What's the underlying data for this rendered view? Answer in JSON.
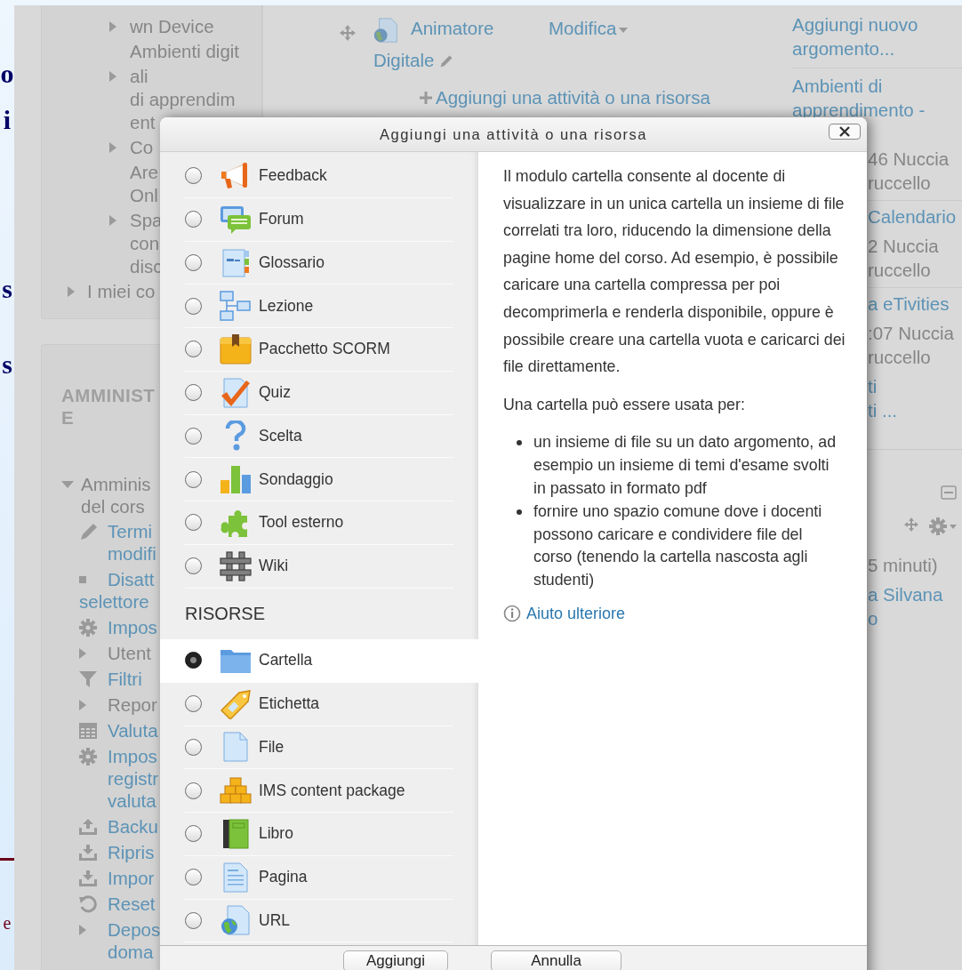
{
  "slide": {
    "letters": [
      {
        "text": "o",
        "kind": "title"
      },
      {
        "text": "i",
        "kind": "title"
      },
      {
        "text": "s",
        "kind": "title"
      },
      {
        "text": "s",
        "kind": "title"
      },
      {
        "text": "e",
        "kind": "footer"
      }
    ]
  },
  "left_column": {
    "cards": [
      {
        "items": [
          {
            "children": [
              {
                "kind": "collapsed",
                "link": false,
                "lines": [
                  "wn Device"
                ]
              },
              {
                "kind": "plain",
                "link": false,
                "lines": [
                  "Ambienti digit"
                ]
              },
              {
                "kind": "collapsed",
                "link": false,
                "lines": [
                  "ali",
                  "di apprendim",
                  "ent"
                ]
              },
              {
                "kind": "collapsed",
                "link": false,
                "lines": [
                  "Co"
                ]
              },
              {
                "kind": "plain",
                "link": false,
                "lines": [
                  "Are",
                  "Onl"
                ]
              },
              {
                "kind": "collapsed",
                "link": false,
                "lines": [
                  "Spa",
                  "con",
                  "disc"
                ]
              }
            ]
          },
          {
            "kind": "collapsed",
            "link": false,
            "lines": [
              "I miei co"
            ]
          }
        ]
      },
      {
        "heading": [
          "AMMINIST",
          "E"
        ],
        "items": [
          {
            "kind": "expanded",
            "link": false,
            "lines": [
              "Amminis",
              "del cors"
            ],
            "children": [
              {
                "kind": "edit",
                "link": true,
                "lines": [
                  "Termi",
                  "modifi"
                ]
              },
              {
                "kind": "toggle",
                "link": true,
                "lines": [
                  "Disatt",
                  "selettore"
                ]
              },
              {
                "kind": "settings",
                "link": true,
                "lines": [
                  "Impos"
                ]
              },
              {
                "kind": "collapsed",
                "link": false,
                "lines": [
                  "Utent"
                ]
              },
              {
                "kind": "filter",
                "link": true,
                "lines": [
                  "Filtri"
                ]
              },
              {
                "kind": "collapsed",
                "link": false,
                "lines": [
                  "Repor"
                ]
              },
              {
                "kind": "grades",
                "link": true,
                "lines": [
                  "Valuta"
                ]
              },
              {
                "kind": "settings",
                "link": true,
                "lines": [
                  "Impos",
                  "registr",
                  "valuta"
                ]
              },
              {
                "kind": "backup",
                "link": true,
                "lines": [
                  "Backu"
                ]
              },
              {
                "kind": "restore",
                "link": true,
                "lines": [
                  "Ripris"
                ]
              },
              {
                "kind": "restore",
                "link": true,
                "lines": [
                  "Impor"
                ]
              },
              {
                "kind": "reset",
                "link": true,
                "lines": [
                  "Reset"
                ]
              },
              {
                "kind": "collapsed",
                "link": true,
                "lines": [
                  "Depos",
                  "doma"
                ]
              }
            ]
          }
        ]
      }
    ]
  },
  "middle_column": {
    "activity_lines": [
      "Animatore",
      "Digitale"
    ],
    "edit_menu": "Modifica",
    "add_link": "Aggiungi una attività o una risorsa"
  },
  "right_column": {
    "top_entries": [
      {
        "kind": "link",
        "lines": [
          "Aggiungi nuovo",
          "argomento..."
        ]
      },
      {
        "kind": "divider"
      },
      {
        "kind": "link",
        "lines": [
          "Ambienti di",
          "apprendimento -"
        ]
      }
    ],
    "side_entries": [
      {
        "kind": "meta",
        "lines": [
          "46 Nuccia",
          "ruccello"
        ]
      },
      {
        "kind": "divider"
      },
      {
        "kind": "link",
        "lines": [
          "Calendario"
        ]
      },
      {
        "kind": "meta",
        "lines": [
          "2 Nuccia",
          "ruccello"
        ]
      },
      {
        "kind": "divider"
      },
      {
        "kind": "link",
        "lines": [
          "a eTivities"
        ]
      },
      {
        "kind": "meta",
        "lines": [
          ":07 Nuccia",
          "ruccello"
        ]
      },
      {
        "kind": "link",
        "lines": [
          "ti",
          "ti ..."
        ]
      },
      {
        "kind": "block-end"
      },
      {
        "kind": "toolbar"
      },
      {
        "kind": "meta",
        "lines": [
          "5 minuti)"
        ]
      },
      {
        "kind": "link",
        "lines": [
          "a Silvana",
          "o"
        ]
      }
    ]
  },
  "dialog": {
    "title": "Aggiungi una attività o una risorsa",
    "activities": [
      {
        "label": "Feedback",
        "selected": false
      },
      {
        "label": "Forum",
        "selected": false
      },
      {
        "label": "Glossario",
        "selected": false
      },
      {
        "label": "Lezione",
        "selected": false
      },
      {
        "label": "Pacchetto SCORM",
        "selected": false
      },
      {
        "label": "Quiz",
        "selected": false
      },
      {
        "label": "Scelta",
        "selected": false
      },
      {
        "label": "Sondaggio",
        "selected": false
      },
      {
        "label": "Tool esterno",
        "selected": false
      },
      {
        "label": "Wiki",
        "selected": false
      }
    ],
    "resources_heading": "RISORSE",
    "resources": [
      {
        "label": "Cartella",
        "selected": true
      },
      {
        "label": "Etichetta",
        "selected": false
      },
      {
        "label": "File",
        "selected": false
      },
      {
        "label": "IMS content package",
        "selected": false
      },
      {
        "label": "Libro",
        "selected": false
      },
      {
        "label": "Pagina",
        "selected": false
      },
      {
        "label": "URL",
        "selected": false
      }
    ],
    "description": {
      "paragraphs": [
        "Il modulo cartella consente al docente di visualizzare in un unica cartella un insieme di file correlati tra loro, riducendo la dimensione della pagine home del corso. Ad esempio, è possibile caricare una cartella compressa per poi decomprimerla e renderla disponibile, oppure è possibile creare una cartella vuota e caricarci dei file direttamente.",
        "Una cartella può essere usata per:"
      ],
      "bullets": [
        "un insieme di file su un dato argomento, ad esempio un insieme di temi d'esame svolti in passato in formato pdf",
        "fornire uno spazio comune dove i docenti possono caricare e condividere file del corso (tenendo la cartella nascosta agli studenti)"
      ],
      "help_link": "Aiuto ulteriore"
    },
    "buttons": [
      "Aggiungi",
      "Annulla"
    ]
  }
}
